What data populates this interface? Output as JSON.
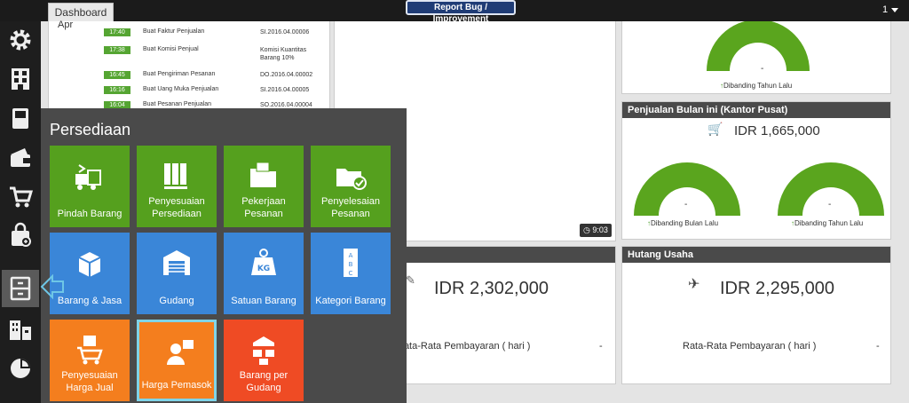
{
  "topbar": {
    "tab_dashboard": "Dashboard",
    "report_button": "Report Bug / Improvement",
    "user_indicator": "1"
  },
  "sidebar": {
    "items": [
      {
        "icon": "gear-icon"
      },
      {
        "icon": "building-icon"
      },
      {
        "icon": "book-icon"
      },
      {
        "icon": "wallet-icon"
      },
      {
        "icon": "cart-icon"
      },
      {
        "icon": "shopping-bag-icon"
      },
      {
        "icon": "cabinet-icon",
        "active": true
      },
      {
        "icon": "buildings-icon"
      },
      {
        "icon": "pie-chart-icon"
      }
    ]
  },
  "activity": {
    "header_fragment": "Apr",
    "rows": [
      {
        "time": "17:40",
        "text": "Buat Faktur Penjualan",
        "ref": "SI.2016.04.00006"
      },
      {
        "time": "17:38",
        "text": "Buat Komisi Penjual",
        "ref": "Komisi Kuantitas Barang 10%"
      },
      {
        "time": "16:45",
        "text": "Buat Pengiriman Pesanan",
        "ref": "DO.2016.04.00002"
      },
      {
        "time": "16:16",
        "text": "Buat Uang Muka Penjualan",
        "ref": "SI.2016.04.00005"
      },
      {
        "time": "16:04",
        "text": "Buat Pesanan Penjualan",
        "ref": "SO.2016.04.00004"
      }
    ]
  },
  "clock": {
    "time": "9:03"
  },
  "top_right_card": {
    "dash": "-",
    "caption": "Dibanding Tahun Lalu"
  },
  "sales_card": {
    "title": "Penjualan Bulan ini (Kantor Pusat)",
    "amount": "IDR 1,665,000",
    "gauge_left": {
      "dash": "-",
      "caption": "Dibanding Bulan Lalu"
    },
    "gauge_right": {
      "dash": "-",
      "caption": "Dibanding Tahun Lalu"
    }
  },
  "receivable_card": {
    "amount": "IDR 2,302,000",
    "label": "Rata-Rata Pembayaran ( hari )",
    "value": "-"
  },
  "hutang_card": {
    "title": "Hutang Usaha",
    "amount": "IDR 2,295,000",
    "label": "Rata-Rata Pembayaran ( hari )",
    "value": "-"
  },
  "popup": {
    "title": "Persediaan",
    "tiles": [
      {
        "label": "Pindah Barang",
        "icon": "forklift-icon",
        "color": "#55a01e"
      },
      {
        "label": "Penyesuaian Persediaan",
        "icon": "binders-icon",
        "color": "#55a01e"
      },
      {
        "label": "Pekerjaan Pesanan",
        "icon": "folder-icon",
        "color": "#55a01e"
      },
      {
        "label": "Penyelesaian Pesanan",
        "icon": "folder-check-icon",
        "color": "#55a01e"
      },
      {
        "label": "Barang & Jasa",
        "icon": "box-icon",
        "color": "#3a86d8"
      },
      {
        "label": "Gudang",
        "icon": "warehouse-icon",
        "color": "#3a86d8"
      },
      {
        "label": "Satuan Barang",
        "icon": "weight-kg-icon",
        "color": "#3a86d8"
      },
      {
        "label": "Kategori Barang",
        "icon": "abc-list-icon",
        "color": "#3a86d8"
      },
      {
        "label": "Penyesuaian Harga Jual",
        "icon": "price-cart-icon",
        "color": "#f47e1e"
      },
      {
        "label": "Harga Pemasok",
        "icon": "supplier-price-icon",
        "color": "#f47e1e",
        "selected": true
      },
      {
        "label": "Barang per Gudang",
        "icon": "goods-warehouse-icon",
        "color": "#ef4b24"
      }
    ]
  },
  "colors": {
    "gauge_green": "#5aa51e",
    "dark_header": "#4a4a4a",
    "selection_border": "#7fd4e8",
    "arrow_outline": "#6ec6e6"
  }
}
